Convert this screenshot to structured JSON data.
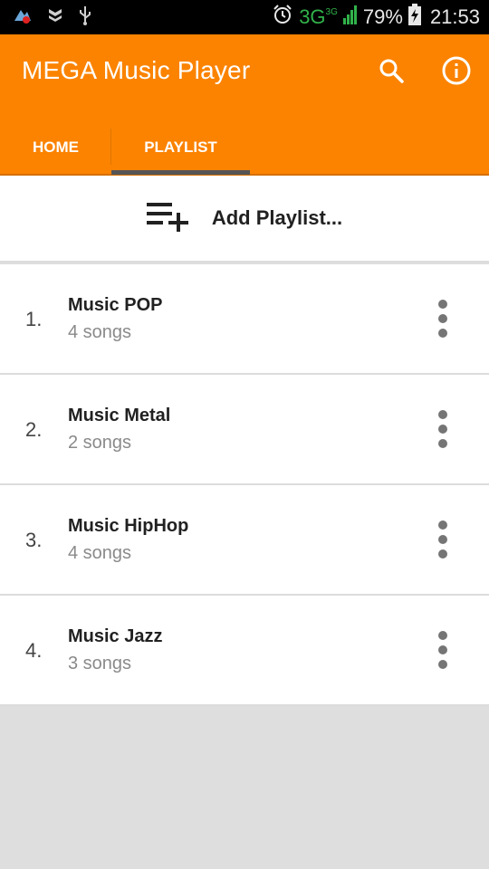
{
  "status_bar": {
    "network": "3G",
    "network_small": "3G",
    "battery": "79%",
    "time": "21:53",
    "icons": [
      "notification-icon",
      "shield-icon",
      "usb-icon",
      "alarm-icon",
      "signal-icon",
      "battery-charging-icon"
    ]
  },
  "app": {
    "title": "MEGA Music Player",
    "actions": [
      "search-icon",
      "info-icon"
    ],
    "accent_color": "#fb8300"
  },
  "tabs": [
    {
      "label": "HOME",
      "selected": false
    },
    {
      "label": "PLAYLIST",
      "selected": true
    }
  ],
  "add_playlist": {
    "label": "Add Playlist...",
    "icon": "playlist-add-icon"
  },
  "playlists": [
    {
      "number": "1.",
      "title": "Music POP",
      "subtitle": "4 songs"
    },
    {
      "number": "2.",
      "title": "Music Metal",
      "subtitle": "2 songs"
    },
    {
      "number": "3.",
      "title": "Music HipHop",
      "subtitle": "4 songs"
    },
    {
      "number": "4.",
      "title": "Music Jazz",
      "subtitle": "3 songs"
    }
  ]
}
